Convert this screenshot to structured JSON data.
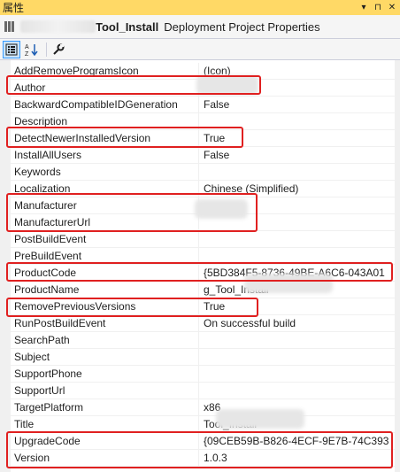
{
  "window": {
    "title": "属性",
    "dropdown_glyph": "▾",
    "pin_glyph": "⊓",
    "close_glyph": "✕"
  },
  "header": {
    "object_name": "Tool_Install",
    "object_type": "Deployment Project Properties"
  },
  "toolbar": {
    "categorized_icon": "categorized-icon",
    "alphabetical_icon": "alphabetical-icon",
    "property_pages_icon": "wrench-icon"
  },
  "properties": [
    {
      "name": "AddRemoveProgramsIcon",
      "value": "(Icon)"
    },
    {
      "name": "Author",
      "value": ""
    },
    {
      "name": "BackwardCompatibleIDGeneration",
      "value": "False"
    },
    {
      "name": "Description",
      "value": ""
    },
    {
      "name": "DetectNewerInstalledVersion",
      "value": "True"
    },
    {
      "name": "InstallAllUsers",
      "value": "False"
    },
    {
      "name": "Keywords",
      "value": ""
    },
    {
      "name": "Localization",
      "value": "Chinese (Simplified)"
    },
    {
      "name": "Manufacturer",
      "value": ""
    },
    {
      "name": "ManufacturerUrl",
      "value": ""
    },
    {
      "name": "PostBuildEvent",
      "value": ""
    },
    {
      "name": "PreBuildEvent",
      "value": ""
    },
    {
      "name": "ProductCode",
      "value": "{5BD384F5-8736-49BE-A6C6-043A01"
    },
    {
      "name": "ProductName",
      "value": "g_Tool_Install"
    },
    {
      "name": "RemovePreviousVersions",
      "value": "True"
    },
    {
      "name": "RunPostBuildEvent",
      "value": "On successful build"
    },
    {
      "name": "SearchPath",
      "value": ""
    },
    {
      "name": "Subject",
      "value": ""
    },
    {
      "name": "SupportPhone",
      "value": ""
    },
    {
      "name": "SupportUrl",
      "value": ""
    },
    {
      "name": "TargetPlatform",
      "value": "x86"
    },
    {
      "name": "Title",
      "value": "Tool_Install"
    },
    {
      "name": "UpgradeCode",
      "value": "{09CEB59B-B826-4ECF-9E7B-74C393"
    },
    {
      "name": "Version",
      "value": "1.0.3"
    }
  ],
  "colors": {
    "title_bar": "#ffd966",
    "highlight_border": "#e02020",
    "grid_line": "#f0f0f0"
  }
}
